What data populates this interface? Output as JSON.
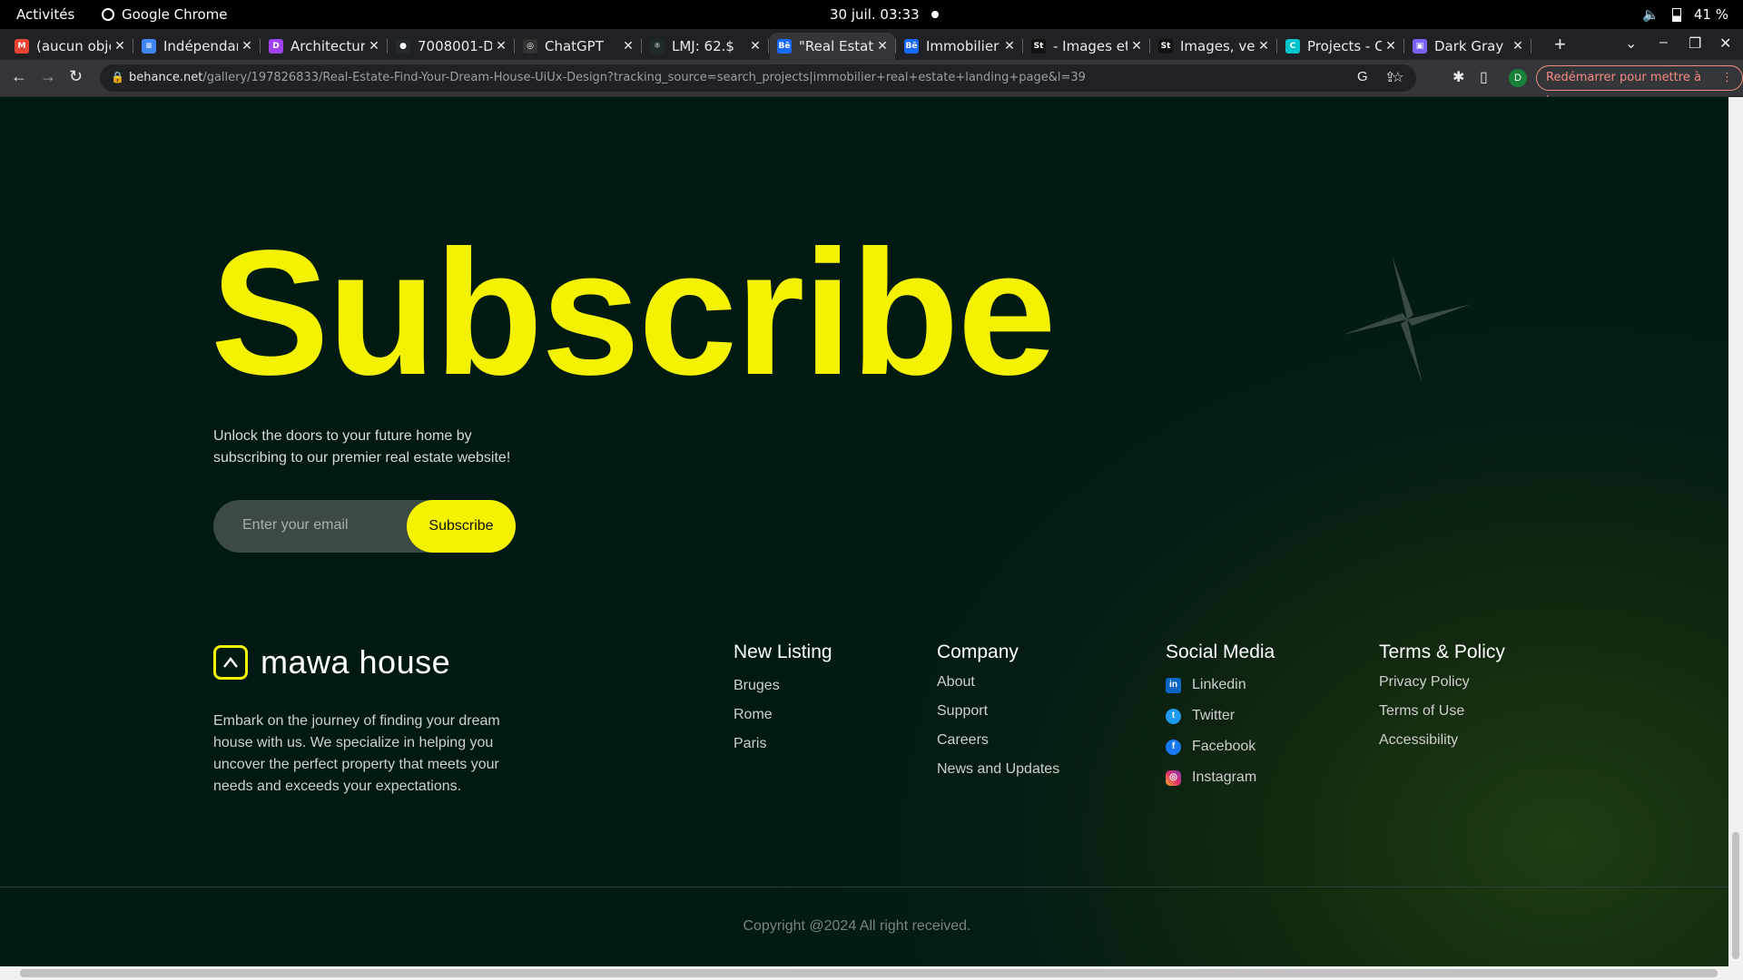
{
  "os": {
    "activities": "Activités",
    "app": "Google Chrome",
    "clock": "30 juil.  03:33",
    "battery": "41 %"
  },
  "tabs": [
    {
      "label": "(aucun obje",
      "icon": "gmail-icon",
      "color": "#ea4335",
      "letter": "M"
    },
    {
      "label": "Indépendan",
      "icon": "docs-icon",
      "color": "#4285f4",
      "letter": "≡"
    },
    {
      "label": "Architectur",
      "icon": "app-icon",
      "color": "#a142f4",
      "letter": "D"
    },
    {
      "label": "7008001-D",
      "icon": "github-icon",
      "color": "#24292e",
      "letter": "●"
    },
    {
      "label": "ChatGPT",
      "icon": "chatgpt-icon",
      "color": "#333",
      "letter": "◎"
    },
    {
      "label": "LMJ: 62.$",
      "icon": "react-icon",
      "color": "#1e2a2e",
      "letter": "⚛"
    },
    {
      "label": "\"Real Estat",
      "icon": "behance-icon",
      "color": "#1769ff",
      "letter": "Bē"
    },
    {
      "label": "Immobilier",
      "icon": "behance-icon",
      "color": "#1769ff",
      "letter": "Bē"
    },
    {
      "label": "- Images et",
      "icon": "stock-icon",
      "color": "#111",
      "letter": "St"
    },
    {
      "label": "Images, ve",
      "icon": "stock-icon",
      "color": "#111",
      "letter": "St"
    },
    {
      "label": "Projects - C",
      "icon": "canva-icon",
      "color": "#00c4cc",
      "letter": "C"
    },
    {
      "label": "Dark Gray",
      "icon": "site-icon",
      "color": "#7b61ff",
      "letter": "▣"
    }
  ],
  "address": {
    "host": "behance.net",
    "path": "/gallery/197826833/Real-Estate-Find-Your-Dream-House-UiUx-Design?tracking_source=search_projects|immobilier+real+estate+landing+page&l=39",
    "avatar": "D",
    "update": "Redémarrer pour mettre à jour"
  },
  "hero": {
    "title": "Subscribe",
    "subtitle": "Unlock the doors to your future home by subscribing to our premier real estate website!",
    "email_placeholder": "Enter your email",
    "button": "Subscribe"
  },
  "brand": {
    "name": "mawa house",
    "about": "Embark on the journey of finding your dream house with us. We specialize in helping you uncover the perfect property that meets your needs and exceeds your expectations."
  },
  "columns": {
    "listing": {
      "title": "New Listing",
      "items": [
        "Bruges",
        "Rome",
        "Paris"
      ]
    },
    "company": {
      "title": "Company",
      "items": [
        "About",
        "Support",
        "Careers",
        "News and Updates"
      ]
    },
    "social": {
      "title": "Social Media",
      "items": [
        "Linkedin",
        "Twitter",
        "Facebook",
        "Instagram"
      ]
    },
    "terms": {
      "title": "Terms & Policy",
      "items": [
        "Privacy Policy",
        "Terms of Use",
        "Accessibility"
      ]
    }
  },
  "copyright": "Copyright @2024 All right received.",
  "colors": {
    "accent": "#f5f200",
    "background": "#001a12"
  }
}
